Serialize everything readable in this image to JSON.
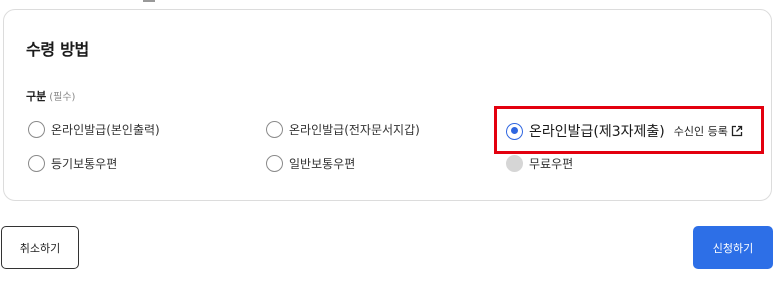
{
  "section": {
    "title": "수령 방법",
    "category_label": "구분",
    "required_text": "(필수)"
  },
  "options": [
    {
      "label": "온라인발급(본인출력)",
      "checked": false,
      "disabled": false
    },
    {
      "label": "온라인발급(전자문서지갑)",
      "checked": false,
      "disabled": false
    },
    {
      "label": "온라인발급(제3자제출)",
      "checked": true,
      "disabled": false,
      "link_label": "수신인 등록",
      "link_icon": "external-link-icon"
    },
    {
      "label": "등기보통우편",
      "checked": false,
      "disabled": false
    },
    {
      "label": "일반보통우편",
      "checked": false,
      "disabled": false
    },
    {
      "label": "무료우편",
      "checked": false,
      "disabled": true
    }
  ],
  "buttons": {
    "cancel": "취소하기",
    "apply": "신청하기"
  },
  "colors": {
    "accent": "#2d6fe7",
    "highlight": "#e3000f"
  }
}
